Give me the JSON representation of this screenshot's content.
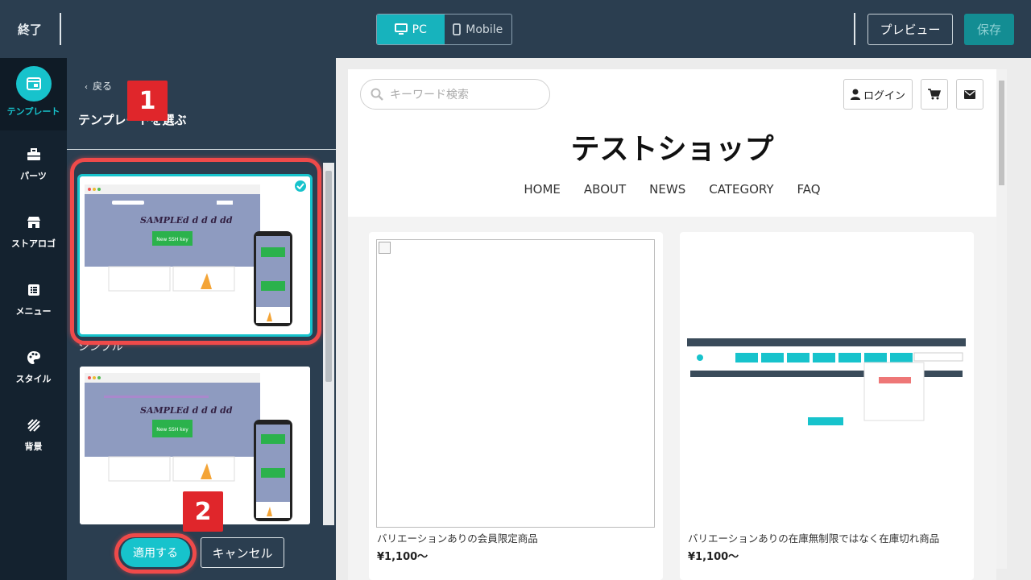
{
  "topbar": {
    "exit_label": "終了",
    "pc_label": "PC",
    "mobile_label": "Mobile",
    "preview_label": "プレビュー",
    "save_label": "保存"
  },
  "nav": {
    "items": [
      {
        "label": "テンプレート",
        "icon": "template-icon"
      },
      {
        "label": "パーツ",
        "icon": "toolbox-icon"
      },
      {
        "label": "ストアロゴ",
        "icon": "store-icon"
      },
      {
        "label": "メニュー",
        "icon": "list-icon"
      },
      {
        "label": "スタイル",
        "icon": "palette-icon"
      },
      {
        "label": "背景",
        "icon": "stripes-icon"
      }
    ]
  },
  "panel": {
    "back_label": "戻る",
    "title": "テンプレートを選ぶ",
    "templates": [
      {
        "label": "シンプル",
        "preview_title": "SAMPLEd d d d dd",
        "preview_button": "New SSH key",
        "selected": true
      },
      {
        "label": "",
        "preview_title": "SAMPLEd d d d dd",
        "preview_button": "New SSH key",
        "selected": false
      }
    ],
    "apply_label": "適用する",
    "cancel_label": "キャンセル"
  },
  "annotations": {
    "badge1": "1",
    "badge2": "2"
  },
  "shop": {
    "search_placeholder": "キーワード検索",
    "login_label": "ログイン",
    "title": "テストショップ",
    "nav": [
      "HOME",
      "ABOUT",
      "NEWS",
      "CATEGORY",
      "FAQ"
    ],
    "products": [
      {
        "name": "バリエーションありの会員限定商品",
        "price": "¥1,100〜"
      },
      {
        "name": "バリエーションありの在庫無制限ではなく在庫切れ商品",
        "price": "¥1,100〜"
      }
    ]
  },
  "colors": {
    "accent": "#17c3cc",
    "topbar": "#2b3e50",
    "nav": "#0f1b26",
    "highlight": "#ef4a4a"
  }
}
